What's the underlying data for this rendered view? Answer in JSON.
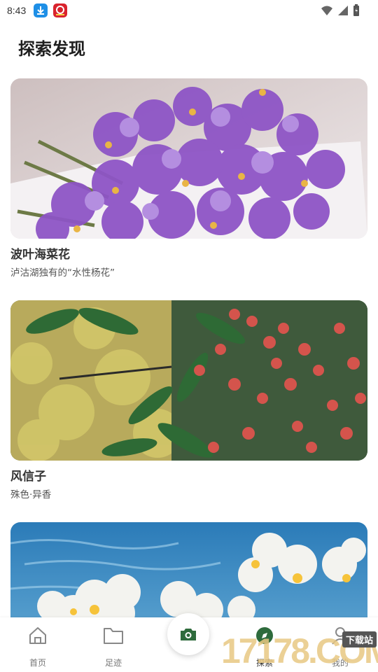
{
  "status_bar": {
    "time": "8:43",
    "icons": [
      "download-app-icon",
      "store-app-icon",
      "wifi-icon",
      "signal-icon",
      "battery-icon"
    ]
  },
  "page": {
    "title": "探索发现"
  },
  "cards": [
    {
      "title": "波叶海菜花",
      "subtitle": "泸沽湖独有的“水性杨花”",
      "image": "purple-freesia-flowers-photo"
    },
    {
      "title": "风信子",
      "subtitle": "殊色·异香",
      "image": "red-berries-and-green-leaves-photo"
    },
    {
      "title": "",
      "subtitle": "",
      "image": "white-water-flowers-photo"
    }
  ],
  "nav": {
    "items": [
      {
        "label": "首页",
        "icon": "home-icon"
      },
      {
        "label": "足迹",
        "icon": "folder-icon"
      },
      {
        "label": "",
        "icon": "camera-icon"
      },
      {
        "label": "探索",
        "icon": "explore-icon"
      },
      {
        "label": "我的",
        "icon": "user-icon"
      }
    ]
  },
  "watermark": {
    "text": "17178.COM",
    "badge": "下载站"
  },
  "colors": {
    "accent": "#2e6b3c",
    "card_title": "#333333"
  }
}
